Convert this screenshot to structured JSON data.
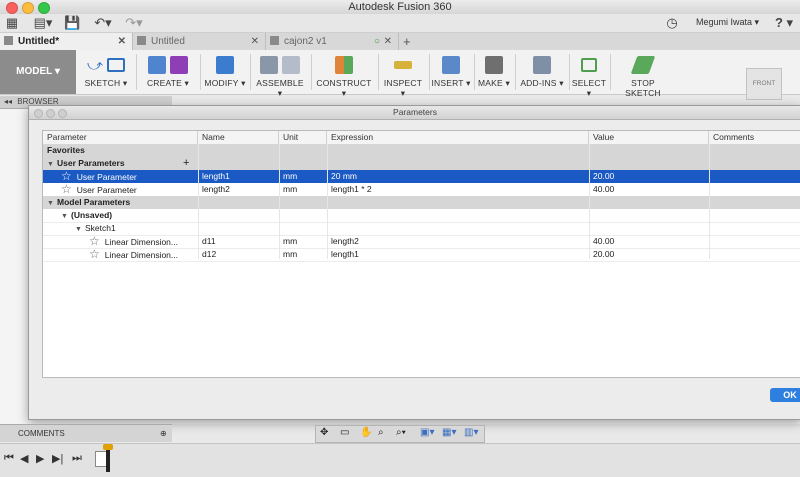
{
  "window": {
    "title": "Autodesk Fusion 360"
  },
  "appbar": {
    "user_name": "Megumi Iwata",
    "help_label": "?"
  },
  "tabs": [
    {
      "label": "Untitled*",
      "active": true
    },
    {
      "label": "Untitled",
      "active": false
    },
    {
      "label": "cajon2 v1",
      "active": false
    }
  ],
  "toolbar": {
    "workspace": "MODEL ▾",
    "groups": [
      {
        "label": "SKETCH ▾",
        "color": "#2f6fbf"
      },
      {
        "label": "CREATE ▾",
        "color": "#8e3fb5"
      },
      {
        "label": "MODIFY ▾",
        "color": "#3b7ccf"
      },
      {
        "label": "ASSEMBLE ▾",
        "color": "#8a97a8"
      },
      {
        "label": "CONSTRUCT ▾",
        "color": "#e0843a"
      },
      {
        "label": "INSPECT ▾",
        "color": "#d6b23a"
      },
      {
        "label": "INSERT ▾",
        "color": "#5a88c9"
      },
      {
        "label": "MAKE ▾",
        "color": "#6f6f6f"
      },
      {
        "label": "ADD-INS ▾",
        "color": "#7f8fa6"
      },
      {
        "label": "SELECT ▾",
        "color": "#4e9e4e"
      },
      {
        "label": "STOP SKETCH",
        "color": "#5aa85a"
      }
    ],
    "viewcube_label": "FRONT"
  },
  "browser": {
    "label": "BROWSER"
  },
  "dialog": {
    "title": "Parameters",
    "columns": [
      "Parameter",
      "Name",
      "Unit",
      "Expression",
      "Value",
      "Comments"
    ],
    "rows": [
      {
        "kind": "group",
        "indent": 0,
        "parameter": "Favorites"
      },
      {
        "kind": "group",
        "indent": 0,
        "tri": "▼",
        "parameter": "User Parameters",
        "add": "+"
      },
      {
        "kind": "selected",
        "indent": 1,
        "star": "☆",
        "parameter": "User Parameter",
        "name": "length1",
        "unit": "mm",
        "expression": "20 mm",
        "value": "20.00",
        "comments": ""
      },
      {
        "kind": "plain",
        "indent": 1,
        "star": "☆",
        "parameter": "User Parameter",
        "name": "length2",
        "unit": "mm",
        "expression": "length1 * 2",
        "value": "40.00",
        "comments": ""
      },
      {
        "kind": "group",
        "indent": 0,
        "tri": "▼",
        "parameter": "Model Parameters"
      },
      {
        "kind": "sub",
        "indent": 1,
        "tri": "▼",
        "parameter": "(Unsaved)"
      },
      {
        "kind": "plain",
        "indent": 2,
        "tri": "▼",
        "parameter": "Sketch1"
      },
      {
        "kind": "plain",
        "indent": 3,
        "star": "☆",
        "parameter": "Linear Dimension...",
        "name": "d11",
        "unit": "mm",
        "expression": "length2",
        "value": "40.00",
        "comments": ""
      },
      {
        "kind": "plain",
        "indent": 3,
        "star": "☆",
        "parameter": "Linear Dimension...",
        "name": "d12",
        "unit": "mm",
        "expression": "length1",
        "value": "20.00",
        "comments": ""
      }
    ],
    "ok_label": "OK"
  },
  "comments": {
    "label": "COMMENTS"
  }
}
